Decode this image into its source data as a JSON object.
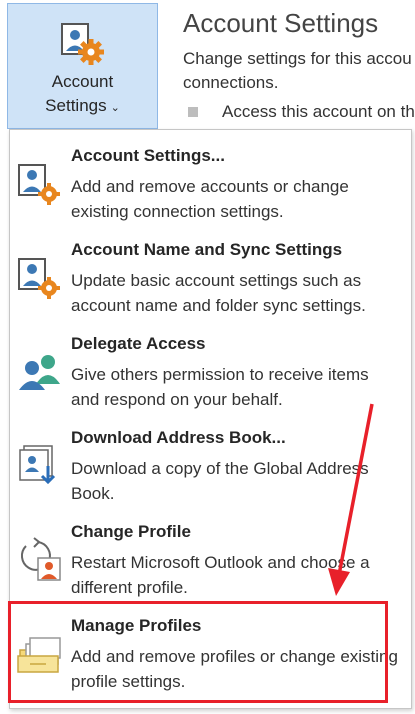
{
  "ribbon": {
    "button_line1": "Account",
    "button_line2": "Settings",
    "chevron": "⌄",
    "icon": "account-settings-icon"
  },
  "backstage": {
    "title": "Account Settings",
    "description_line1": "Change settings for this accou",
    "description_line2": "connections.",
    "bullet": "Access this account on th"
  },
  "menu": {
    "items": [
      {
        "title": "Account Settings...",
        "description": "Add and remove accounts or change existing connection settings.",
        "icon": "account-settings-icon"
      },
      {
        "title": "Account Name and Sync Settings",
        "description": "Update basic account settings such as account name and folder sync settings.",
        "icon": "account-settings-icon"
      },
      {
        "title": "Delegate Access",
        "description": "Give others permission to receive items and respond on your behalf.",
        "icon": "delegate-users-icon"
      },
      {
        "title": "Download Address Book...",
        "description": "Download a copy of the Global Address Book.",
        "icon": "address-book-download-icon"
      },
      {
        "title": "Change Profile",
        "description": "Restart Microsoft Outlook and choose a different profile.",
        "icon": "change-profile-icon"
      },
      {
        "title": "Manage Profiles",
        "description": "Add and remove profiles or change existing profile settings.",
        "icon": "manage-profiles-icon"
      }
    ]
  },
  "annotation_colors": {
    "highlight": "#e8202a",
    "ribbon_selected": "#cfe3f7",
    "icon_blue": "#3c78b4",
    "icon_orange": "#e8861e"
  }
}
